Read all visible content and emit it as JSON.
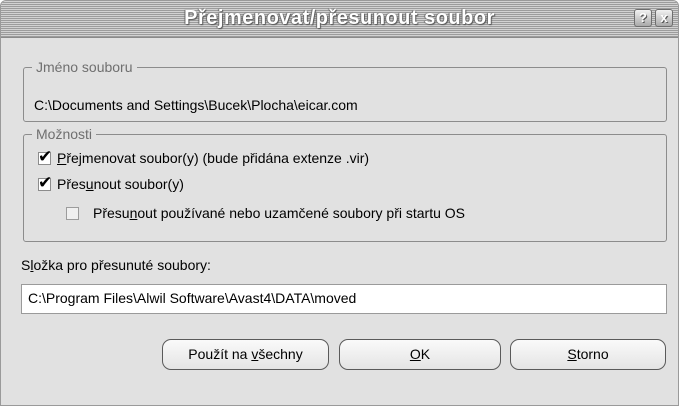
{
  "window": {
    "title": "Přejmenovat/přesunout soubor",
    "help_glyph": "?",
    "close_glyph": "x"
  },
  "file_group": {
    "legend": "Jméno souboru",
    "path": "C:\\Documents and Settings\\Bucek\\Plocha\\eicar.com"
  },
  "options_group": {
    "legend": "Možnosti",
    "options": [
      {
        "pre": "",
        "key": "P",
        "post": "řejmenovat soubor(y) (bude přidána extenze .vir)",
        "checked": true,
        "enabled": true
      },
      {
        "pre": "Přes",
        "key": "u",
        "post": "nout soubor(y)",
        "checked": true,
        "enabled": true
      },
      {
        "pre": "Přesu",
        "key": "n",
        "post": "out používané nebo uzamčené soubory při startu OS",
        "checked": false,
        "enabled": true
      }
    ]
  },
  "folder": {
    "label_pre": "S",
    "label_key": "l",
    "label_post": "ožka pro přesunuté soubory:",
    "value": "C:\\Program Files\\Alwil Software\\Avast4\\DATA\\moved"
  },
  "buttons": {
    "apply_all": {
      "pre": "Použít na ",
      "key": "v",
      "post": "šechny"
    },
    "ok": {
      "pre": "",
      "key": "O",
      "post": "K"
    },
    "cancel": {
      "pre": "",
      "key": "S",
      "post": "torno"
    }
  },
  "colors": {
    "window_bg": "#e1e1e1",
    "title_text": "#ffffff",
    "legend_text": "#6f6f6f"
  }
}
